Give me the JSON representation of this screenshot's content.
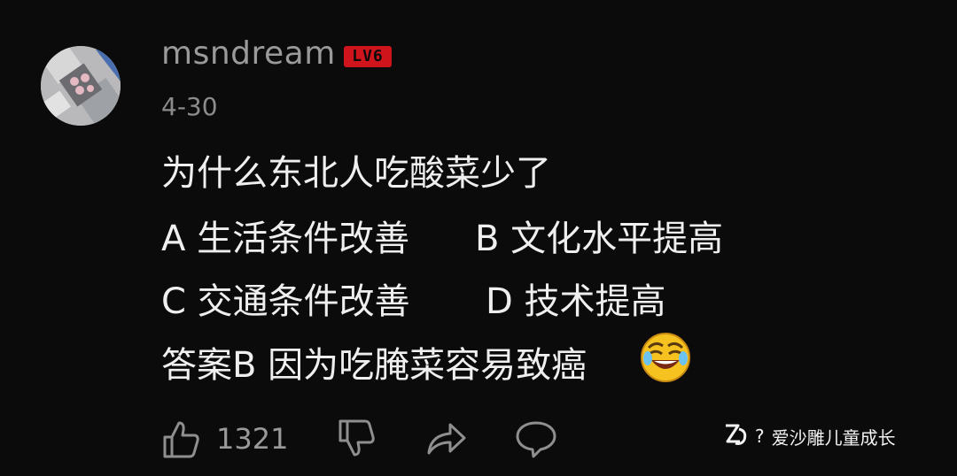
{
  "comment": {
    "username": "msndream",
    "level_badge": "LV6",
    "date": "4-30",
    "lines": {
      "q": "为什么东北人吃酸菜少了",
      "a": "A 生活条件改善",
      "b": "B 文化水平提高",
      "c": "C 交通条件改善",
      "d": "D 技术提高",
      "answer": "答案B 因为吃腌菜容易致癌"
    },
    "emoji": "grinning-sweat-emoji"
  },
  "actions": {
    "like_count": "1321",
    "icons": [
      "thumbs-up-icon",
      "thumbs-down-icon",
      "share-icon",
      "reply-icon"
    ]
  },
  "watermark": {
    "logo": "zhihu-logo-icon",
    "separator": "?",
    "text": "爱沙雕儿童成长"
  },
  "colors": {
    "background": "#0b0b0c",
    "text": "#efefef",
    "muted": "#9a9a9a",
    "badge": "#d0141b"
  }
}
